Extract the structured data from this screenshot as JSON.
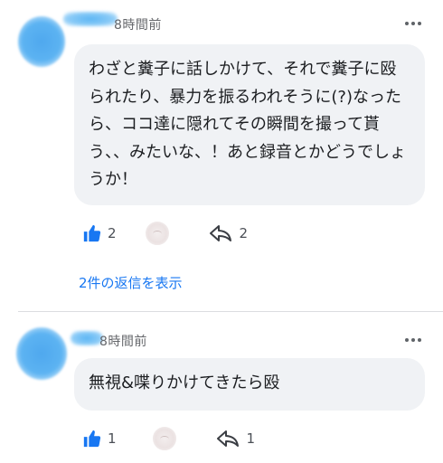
{
  "comments": [
    {
      "time": "8時間前",
      "text": "わざと糞子に話しかけて、それで糞子に殴られたり、暴力を振るわれそうに(?)なったら、ココ達に隠れてその瞬間を撮って貰う、、みたいな、！あと録音とかどうでしょうか！",
      "like_count": "2",
      "reply_count": "2",
      "replies_link": "2件の返信を表示"
    },
    {
      "time": "8時間前",
      "text": "無視&喋りかけてきたら殴",
      "like_count": "1",
      "reply_count": "1"
    }
  ],
  "colors": {
    "accent": "#1877f2",
    "bubble": "#f0f2f5",
    "meta": "#65676b"
  },
  "icons": [
    "thumbs-up-icon",
    "reply-arrow-icon",
    "more-options-icon"
  ]
}
